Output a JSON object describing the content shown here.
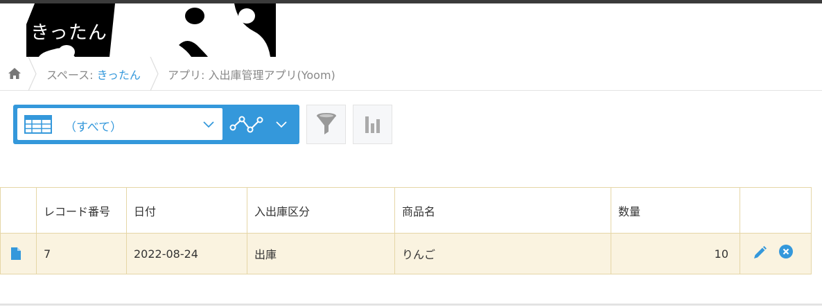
{
  "header": {
    "space_title": "きったん"
  },
  "breadcrumb": {
    "home_icon": "home-icon",
    "space_prefix": "スペース: ",
    "space_name": "きったん",
    "app_label": "アプリ: 入出庫管理アプリ(Yoom)"
  },
  "toolbar": {
    "view_name": "（すべて）",
    "view_icon": "table-icon",
    "graph_icon": "graph-line-icon",
    "filter_icon": "funnel-icon",
    "chart_icon": "bar-chart-icon"
  },
  "table": {
    "columns": [
      "",
      "レコード番号",
      "日付",
      "入出庫区分",
      "商品名",
      "数量",
      ""
    ],
    "rows": [
      {
        "record_no": "7",
        "date": "2022-08-24",
        "type": "出庫",
        "product": "りんご",
        "quantity": "10"
      }
    ]
  },
  "colors": {
    "accent": "#3498db",
    "row_bg": "#faf3e0",
    "border": "#e5d6a6",
    "topbar": "#3b3b3b"
  }
}
